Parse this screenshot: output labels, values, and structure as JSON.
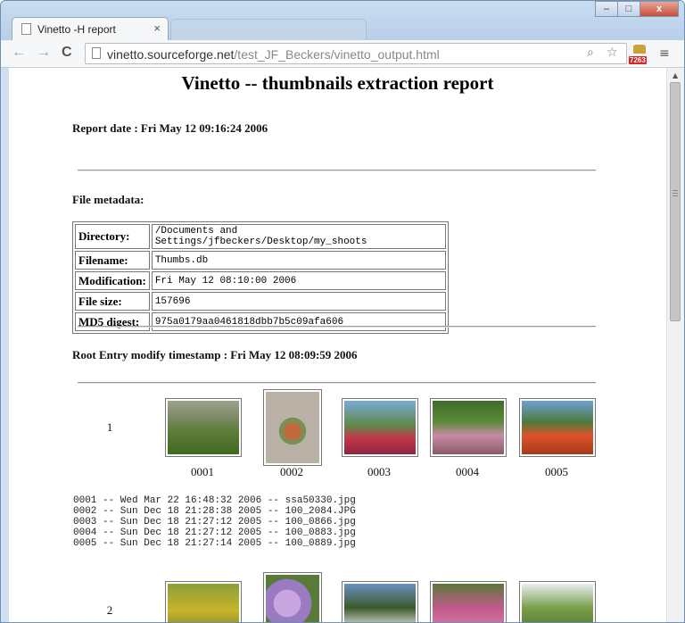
{
  "browser": {
    "tab_title": "Vinetto -H report",
    "tab_close": "×",
    "inactive_tab_title": "",
    "url_host": "vinetto.sourceforge.net",
    "url_path": "/test_JF_Beckers/vinetto_output.html",
    "nav": {
      "back": "←",
      "forward": "→",
      "reload": "C"
    },
    "omnibox_icons": {
      "search": "⌕",
      "bookmark": "☆"
    },
    "extension_badge": "7263",
    "menu": "≡",
    "window_buttons": {
      "minimize": "–",
      "maximize": "□",
      "close": "x"
    }
  },
  "report": {
    "title": "Vinetto -- thumbnails extraction report",
    "report_date": "Report date : Fri May 12 09:16:24 2006",
    "file_metadata_label": "File metadata:",
    "metadata": [
      {
        "key": "Directory:",
        "value": "/Documents and Settings/jfbeckers/Desktop/my_shoots"
      },
      {
        "key": "Filename:",
        "value": "Thumbs.db"
      },
      {
        "key": "Modification:",
        "value": "Fri May 12 08:10:00 2006"
      },
      {
        "key": "File size:",
        "value": "157696"
      },
      {
        "key": "MD5 digest:",
        "value": "975a0179aa0461818dbb7b5c09afa606"
      }
    ],
    "root_entry": "Root Entry modify timestamp : Fri May 12 08:09:59 2006",
    "row1": {
      "number": "1",
      "captions": [
        "0001",
        "0002",
        "0003",
        "0004",
        "0005"
      ],
      "log": [
        "0001 -- Wed Mar 22 16:48:32 2006 -- ssa50330.jpg",
        "0002 -- Sun Dec 18 21:28:38 2005 -- 100_2084.JPG",
        "0003 -- Sun Dec 18 21:27:12 2005 -- 100_0866.jpg",
        "0004 -- Sun Dec 18 21:27:12 2005 -- 100_0883.jpg",
        "0005 -- Sun Dec 18 21:27:14 2005 -- 100_0889.jpg"
      ]
    },
    "row2": {
      "number": "2"
    }
  },
  "colors": {
    "accent_link": "#1a0dab",
    "badge_red": "#d22222"
  }
}
